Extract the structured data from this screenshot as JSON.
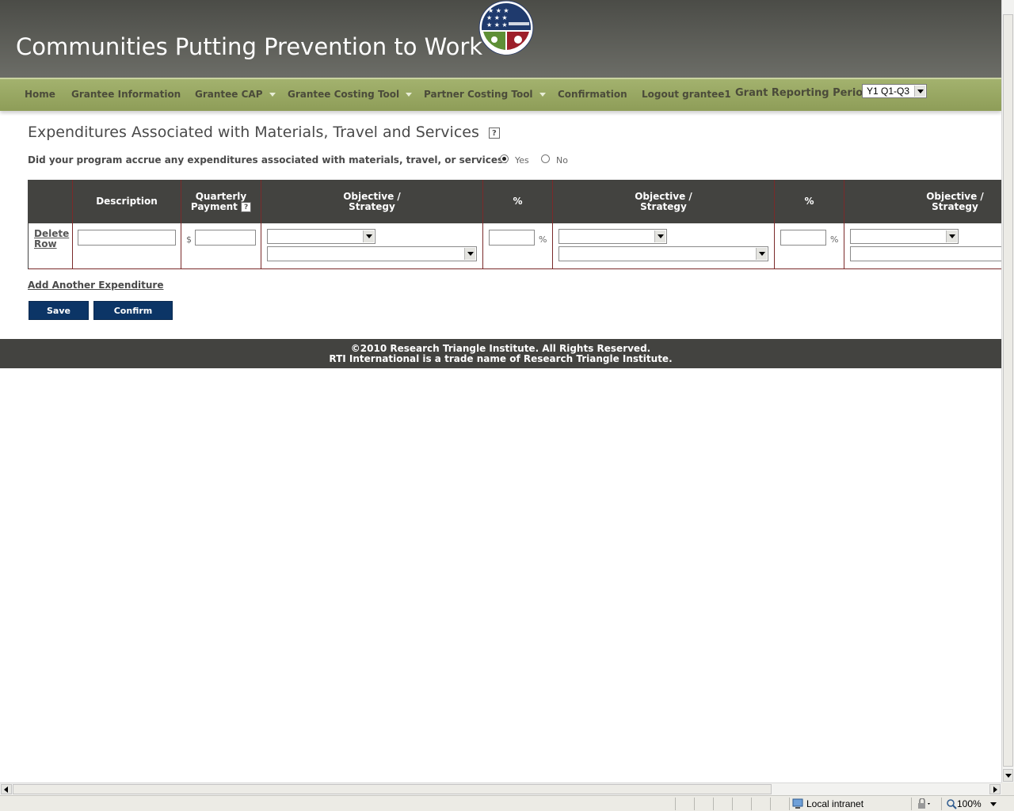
{
  "header": {
    "title": "Communities Putting Prevention to Work"
  },
  "nav": {
    "items": [
      {
        "label": "Home"
      },
      {
        "label": "Grantee Information"
      },
      {
        "label": "Grantee CAP"
      },
      {
        "label": "Grantee Costing Tool"
      },
      {
        "label": "Partner Costing Tool"
      },
      {
        "label": "Confirmation"
      },
      {
        "label": "Logout grantee1"
      }
    ],
    "period_label": "Grant Reporting Period:",
    "period_value": "Y1 Q1-Q3"
  },
  "main": {
    "title": "Expenditures Associated with Materials, Travel and Services",
    "help_glyph": "?",
    "question": "Did your program accrue any expenditures associated with materials, travel, or services?",
    "answer_yes": "Yes",
    "answer_no": "No",
    "selected_answer": "Yes"
  },
  "table": {
    "headers": {
      "description": "Description",
      "quarterly_payment_1": "Quarterly",
      "quarterly_payment_2": "Payment",
      "objective_1": "Objective /",
      "objective_2": "Strategy",
      "percent": "%"
    },
    "row": {
      "delete_1": "Delete",
      "delete_2": "Row",
      "currency": "$",
      "percent_sign": "%",
      "description_value": "",
      "payment_value": "",
      "percent_1_value": "",
      "percent_2_value": ""
    },
    "add_link": "Add Another Expenditure"
  },
  "buttons": {
    "save": "Save",
    "confirm": "Confirm"
  },
  "footer": {
    "line1": "©2010 Research Triangle Institute. All Rights Reserved.",
    "line2": "RTI International is a trade name of Research Triangle Institute."
  },
  "statusbar": {
    "zone": "Local intranet",
    "zoom": "100%"
  },
  "colors": {
    "header_bg": "#5b5c56",
    "nav_bg": "#98a663",
    "table_header_bg": "#434340",
    "button_bg": "#0c3566",
    "footer_bg": "#434340"
  }
}
